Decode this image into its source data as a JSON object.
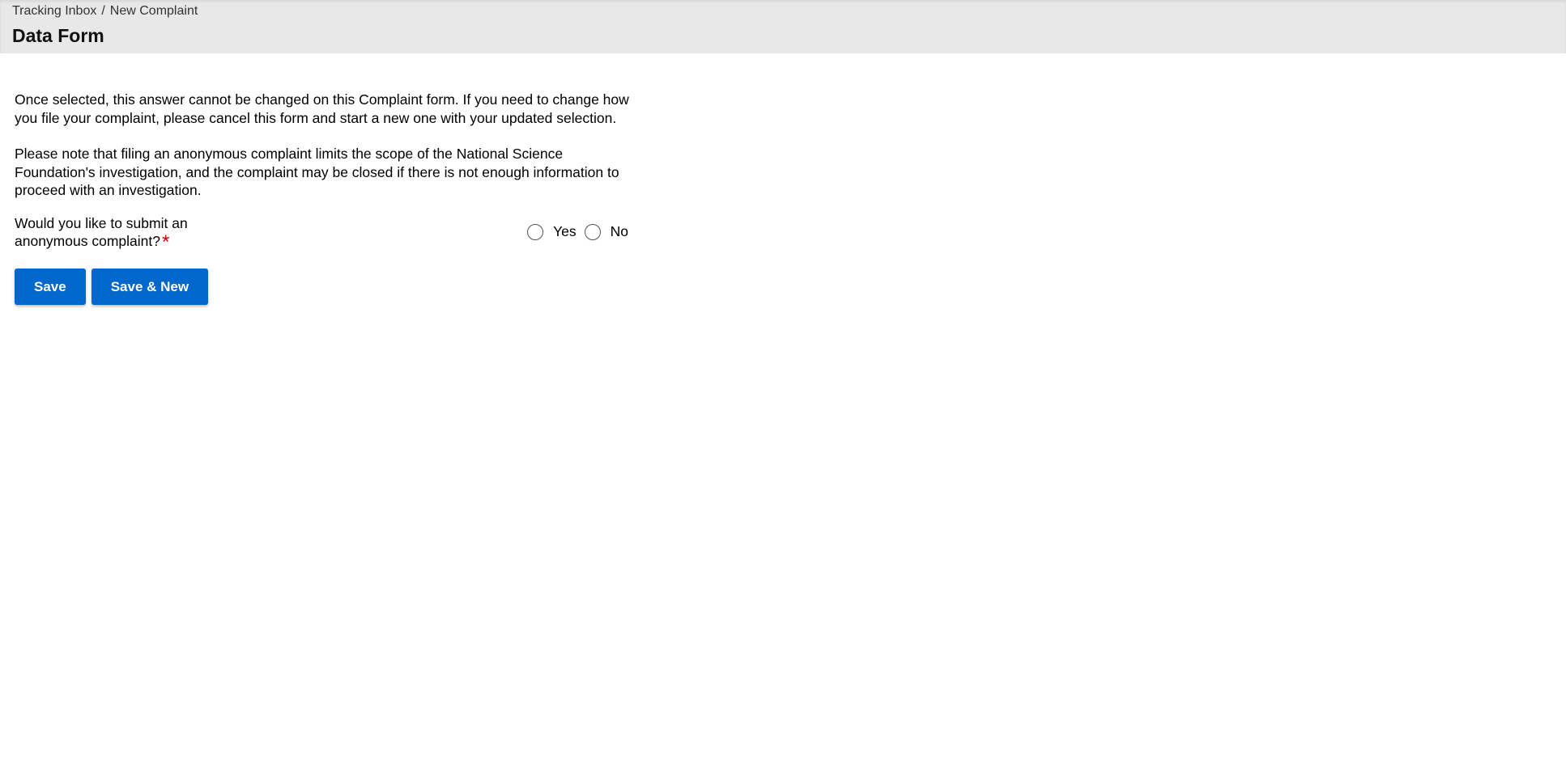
{
  "header": {
    "breadcrumb": [
      {
        "label": "Tracking Inbox"
      },
      {
        "label": "New Complaint"
      }
    ],
    "separator": "/",
    "title": "Data Form"
  },
  "form": {
    "paragraphs": [
      "Once selected, this answer cannot be changed on this Complaint form. If you need to change how you file your complaint, please cancel this form and start a new one with your updated selection.",
      "Please note that filing an anonymous complaint limits the scope of the National Science Foundation's investigation, and the complaint may be closed if there is not enough information to proceed with an investigation."
    ],
    "question": {
      "label": "Would you like to submit an anonymous complaint?",
      "required_marker": "*",
      "options": [
        {
          "label": "Yes",
          "selected": false
        },
        {
          "label": "No",
          "selected": false
        }
      ]
    }
  },
  "actions": {
    "save_label": "Save",
    "save_new_label": "Save & New"
  },
  "colors": {
    "header_bg": "#e8e8e8",
    "primary_button": "#0067cd",
    "required": "#d00000"
  }
}
